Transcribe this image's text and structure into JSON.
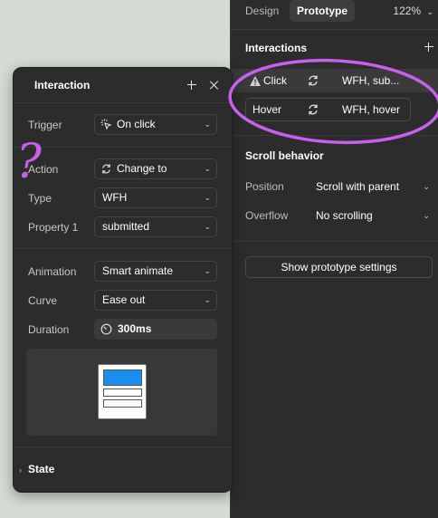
{
  "tabs": {
    "design": "Design",
    "prototype": "Prototype"
  },
  "zoom": {
    "value": "122%",
    "chevron": "⌄"
  },
  "interactions": {
    "title": "Interactions",
    "rows": [
      {
        "trigger": "Click",
        "destination": "WFH, sub..."
      },
      {
        "trigger": "Hover",
        "destination": "WFH, hover"
      }
    ]
  },
  "scroll_behavior": {
    "title": "Scroll behavior",
    "position_label": "Position",
    "position_value": "Scroll with parent",
    "overflow_label": "Overflow",
    "overflow_value": "No scrolling"
  },
  "show_settings_button": "Show prototype settings",
  "panel": {
    "title": "Interaction",
    "trigger_label": "Trigger",
    "trigger_value": "On click",
    "action_label": "Action",
    "action_value": "Change to",
    "type_label": "Type",
    "type_value": "WFH",
    "property_label": "Property 1",
    "property_value": "submitted",
    "animation_label": "Animation",
    "animation_value": "Smart animate",
    "curve_label": "Curve",
    "curve_value": "Ease out",
    "duration_label": "Duration",
    "duration_value": "300ms",
    "state_label": "State"
  },
  "annotation": {
    "question_mark": "?"
  },
  "colors": {
    "canvas": "#d3dbd3",
    "panel": "#2c2c2c",
    "accent_blue": "#1a8ef0",
    "annotation_purple": "#c860ee"
  }
}
